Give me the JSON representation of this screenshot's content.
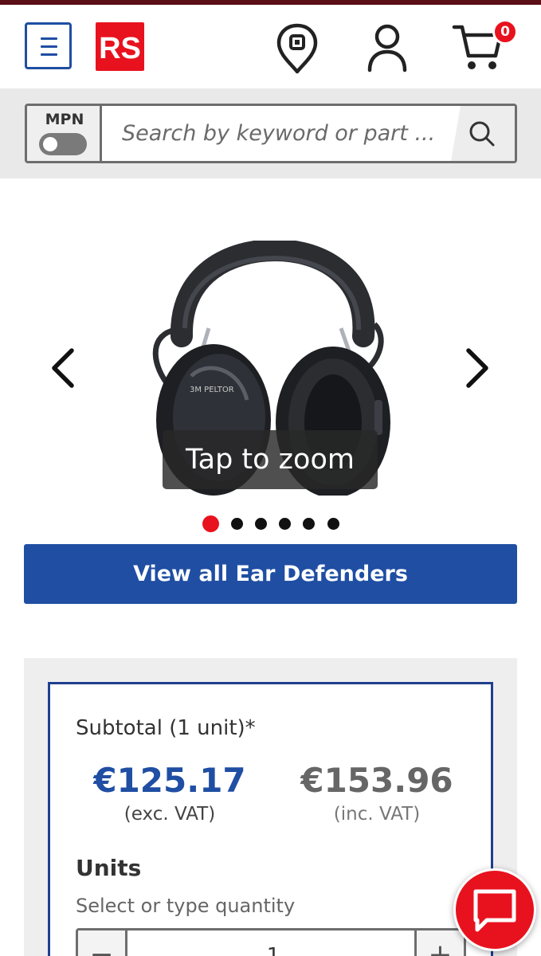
{
  "header": {
    "menu_icon": "hamburger-menu-icon",
    "logo_text": "RS",
    "location_icon": "location-pin-icon",
    "account_icon": "account-icon",
    "cart_icon": "cart-icon",
    "cart_count": "0",
    "colors": {
      "brand_red": "#e8121e",
      "brand_blue": "#1f4ea3"
    }
  },
  "search": {
    "mpn_label": "MPN",
    "mpn_toggle_on": false,
    "placeholder": "Search by keyword or part ...",
    "search_icon": "search-icon"
  },
  "gallery": {
    "prev_icon": "chevron-left-icon",
    "next_icon": "chevron-right-icon",
    "zoom_label": "Tap to zoom",
    "image_count": 6,
    "active_index": 0,
    "image_brand_text": "3M PELTOR"
  },
  "view_all_button": "View all Ear Defenders",
  "pricing": {
    "subtotal_label": "Subtotal (1 unit)*",
    "price_ex_vat": "€125.17",
    "price_ex_vat_note": "(exc. VAT)",
    "price_inc_vat": "€153.96",
    "price_inc_vat_note": "(inc. VAT)",
    "units_label": "Units",
    "units_hint": "Select or type quantity",
    "quantity": "1",
    "minus_label": "−",
    "plus_label": "+"
  },
  "chat_icon": "chat-bubble-icon"
}
